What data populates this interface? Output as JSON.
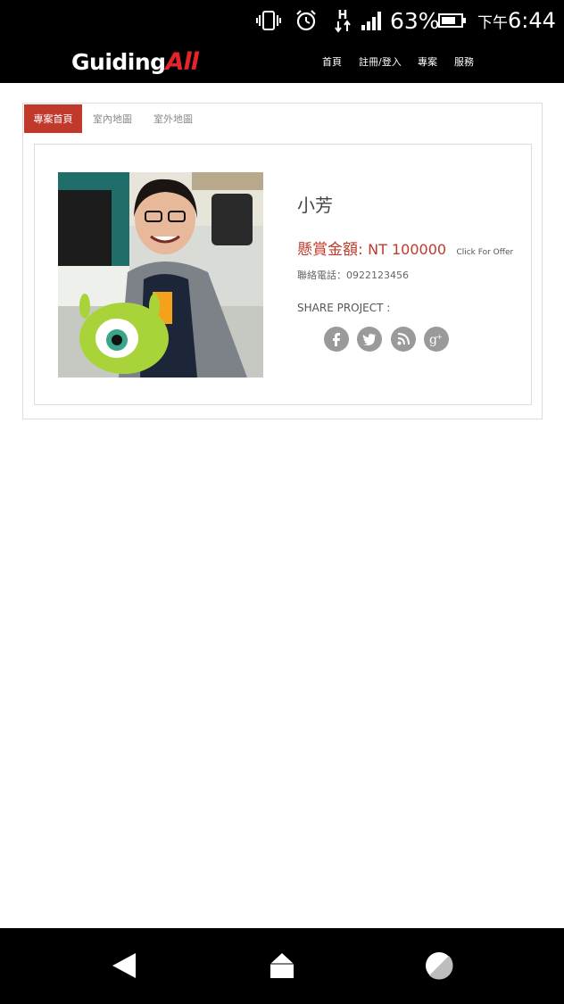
{
  "status_bar": {
    "battery_percent": "63%",
    "time_prefix": "下午",
    "time": "6:44",
    "network_letter": "H",
    "icons": [
      "vibrate-icon",
      "alarm-icon",
      "network-h-icon",
      "signal-icon",
      "battery-icon"
    ]
  },
  "header": {
    "logo_part1": "Guiding",
    "logo_part2": "All",
    "nav": [
      "首頁",
      "註冊/登入",
      "專案",
      "服務"
    ]
  },
  "tabs": [
    {
      "label": "專案首頁",
      "active": true
    },
    {
      "label": "室內地圖",
      "active": false
    },
    {
      "label": "室外地圖",
      "active": false
    }
  ],
  "project": {
    "name": "小芳",
    "reward_label": "懸賞金額:",
    "reward_amount": "NT 100000",
    "offer_link": "Click For Offer",
    "phone_label": "聯絡電話：",
    "phone": "0922123456",
    "share_label": "SHARE PROJECT :",
    "social_icons": [
      "facebook-icon",
      "twitter-icon",
      "rss-icon",
      "google-plus-icon"
    ]
  },
  "colors": {
    "accent": "#c0392b",
    "bar_bg": "#000000",
    "social_bg": "#9a9a9a"
  }
}
